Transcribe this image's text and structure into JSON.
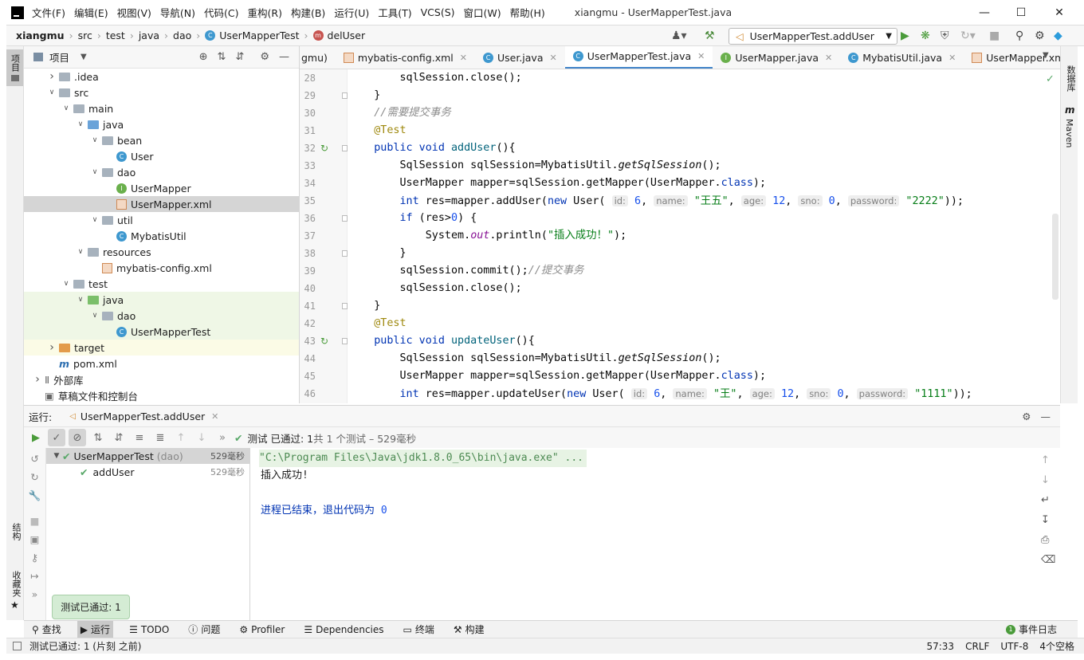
{
  "window": {
    "title": "xiangmu - UserMapperTest.java",
    "menu": [
      "文件(F)",
      "编辑(E)",
      "视图(V)",
      "导航(N)",
      "代码(C)",
      "重构(R)",
      "构建(B)",
      "运行(U)",
      "工具(T)",
      "VCS(S)",
      "窗口(W)",
      "帮助(H)"
    ]
  },
  "nav": {
    "breadcrumbs": [
      "xiangmu",
      "src",
      "test",
      "java",
      "dao",
      "UserMapperTest",
      "delUser"
    ],
    "run_config": "UserMapperTest.addUser"
  },
  "project": {
    "header": "项目",
    "left_strip_label": "项目",
    "tree": [
      {
        "label": "idea",
        "prefix": ".",
        "depth": 1,
        "type": "folder",
        "expanded": false
      },
      {
        "label": "src",
        "depth": 1,
        "type": "folder",
        "expanded": true
      },
      {
        "label": "main",
        "depth": 2,
        "type": "folder",
        "expanded": true
      },
      {
        "label": "java",
        "depth": 3,
        "type": "folder-blue",
        "expanded": true
      },
      {
        "label": "bean",
        "depth": 4,
        "type": "package",
        "expanded": true
      },
      {
        "label": "User",
        "depth": 5,
        "type": "class"
      },
      {
        "label": "dao",
        "depth": 4,
        "type": "package",
        "expanded": true
      },
      {
        "label": "UserMapper",
        "depth": 5,
        "type": "interface"
      },
      {
        "label": "UserMapper.xml",
        "depth": 5,
        "type": "xml",
        "selected": true
      },
      {
        "label": "util",
        "depth": 4,
        "type": "package",
        "expanded": true
      },
      {
        "label": "MybatisUtil",
        "depth": 5,
        "type": "class"
      },
      {
        "label": "resources",
        "depth": 3,
        "type": "folder",
        "expanded": true
      },
      {
        "label": "mybatis-config.xml",
        "depth": 4,
        "type": "xml"
      },
      {
        "label": "test",
        "depth": 2,
        "type": "folder",
        "expanded": true
      },
      {
        "label": "java",
        "depth": 3,
        "type": "folder-green",
        "expanded": true,
        "highlight": true
      },
      {
        "label": "dao",
        "depth": 4,
        "type": "package",
        "expanded": true,
        "highlight": true
      },
      {
        "label": "UserMapperTest",
        "depth": 5,
        "type": "class",
        "highlight": true
      },
      {
        "label": "target",
        "depth": 1,
        "type": "folder-orange",
        "expanded": false,
        "highlight2": true
      },
      {
        "label": "pom.xml",
        "depth": 1,
        "type": "maven"
      },
      {
        "label": "外部库",
        "depth": 0,
        "type": "lib",
        "expanded": false
      },
      {
        "label": "草稿文件和控制台",
        "depth": 0,
        "type": "scratch"
      }
    ]
  },
  "editor": {
    "tabs": [
      {
        "label": "gmu)",
        "icon": "none"
      },
      {
        "label": "mybatis-config.xml",
        "icon": "xml"
      },
      {
        "label": "User.java",
        "icon": "class"
      },
      {
        "label": "UserMapperTest.java",
        "icon": "class",
        "active": true
      },
      {
        "label": "UserMapper.java",
        "icon": "interface"
      },
      {
        "label": "MybatisUtil.java",
        "icon": "class"
      },
      {
        "label": "UserMapper.xml",
        "icon": "xml"
      }
    ],
    "line_numbers": [
      "28",
      "29",
      "30",
      "31",
      "32",
      "33",
      "34",
      "35",
      "36",
      "37",
      "38",
      "39",
      "40",
      "41",
      "42",
      "43",
      "44",
      "45",
      "46"
    ],
    "code": {
      "l28": "sqlSession.close();",
      "l29": "}",
      "l30": "//需要提交事务",
      "l31": "@Test",
      "l32a": "public void ",
      "l32b": "addUser",
      "l32c": "(){",
      "l33a": "SqlSession sqlSession=MybatisUtil.",
      "l33b": "getSqlSession",
      "l33c": "();",
      "l34a": "UserMapper mapper=sqlSession.getMapper(UserMapper.",
      "l34b": "class",
      "l34c": ");",
      "l35a": "int",
      "l35b": " res=mapper.addUser(",
      "l35c": "new",
      "l35d": " User(",
      "l35_h1": "id:",
      "l35_v1": "6",
      "l35_h2": "name:",
      "l35_v2": "\"王五\"",
      "l35_h3": "age:",
      "l35_v3": "12",
      "l35_h4": "sno:",
      "l35_v4": "0",
      "l35_h5": "password:",
      "l35_v5": "\"2222\"",
      "l35e": "));",
      "l36a": "if",
      "l36b": " (res>",
      "l36c": "0",
      "l36d": ") {",
      "l37a": "System.",
      "l37b": "out",
      "l37c": ".println(",
      "l37d": "\"插入成功！\"",
      "l37e": ");",
      "l38": "}",
      "l39a": "sqlSession.commit();",
      "l39b": "//提交事务",
      "l40": "sqlSession.close();",
      "l41": "}",
      "l42": "@Test",
      "l43a": "public void ",
      "l43b": "updateUser",
      "l43c": "(){",
      "l44a": "SqlSession sqlSession=MybatisUtil.",
      "l44b": "getSqlSession",
      "l44c": "();",
      "l45a": "UserMapper mapper=sqlSession.getMapper(UserMapper.",
      "l45b": "class",
      "l45c": ");",
      "l46a": "int",
      "l46b": " res=mapper.updateUser(",
      "l46c": "new",
      "l46d": " User(",
      "l46_h1": "id:",
      "l46_v1": "6",
      "l46_h2": "name:",
      "l46_v2": "\"王\"",
      "l46_h3": "age:",
      "l46_v3": "12",
      "l46_h4": "sno:",
      "l46_v4": "0",
      "l46_h5": "password:",
      "l46_v5": "\"1111\"",
      "l46e": "));"
    }
  },
  "right_strip": {
    "database": "数据库",
    "maven": "Maven"
  },
  "run": {
    "label": "运行:",
    "tab": "UserMapperTest.addUser",
    "status_prefix": "测试 已通过: 1",
    "status_suffix": "共 1 个测试 – 529毫秒",
    "tree": [
      {
        "label": "UserMapperTest",
        "sub": "(dao)",
        "time": "529毫秒"
      },
      {
        "label": "addUser",
        "time": "529毫秒"
      }
    ],
    "console": {
      "cmd": "\"C:\\Program Files\\Java\\jdk1.8.0_65\\bin\\java.exe\" ...",
      "out": "插入成功!",
      "exit_text": "进程已结束，退出代码为 ",
      "exit_code": "0"
    }
  },
  "left_strip_bottom": {
    "structure": "结构",
    "favorites": "收藏夹"
  },
  "toast": "测试已通过: 1",
  "bottom_tools": [
    "查找",
    "运行",
    "TODO",
    "问题",
    "Profiler",
    "Dependencies",
    "终端",
    "构建"
  ],
  "event_log": "事件日志",
  "status": {
    "message": "测试已通过: 1 (片刻 之前)",
    "position": "57:33",
    "line_sep": "CRLF",
    "encoding": "UTF-8",
    "indent": "4个空格"
  }
}
